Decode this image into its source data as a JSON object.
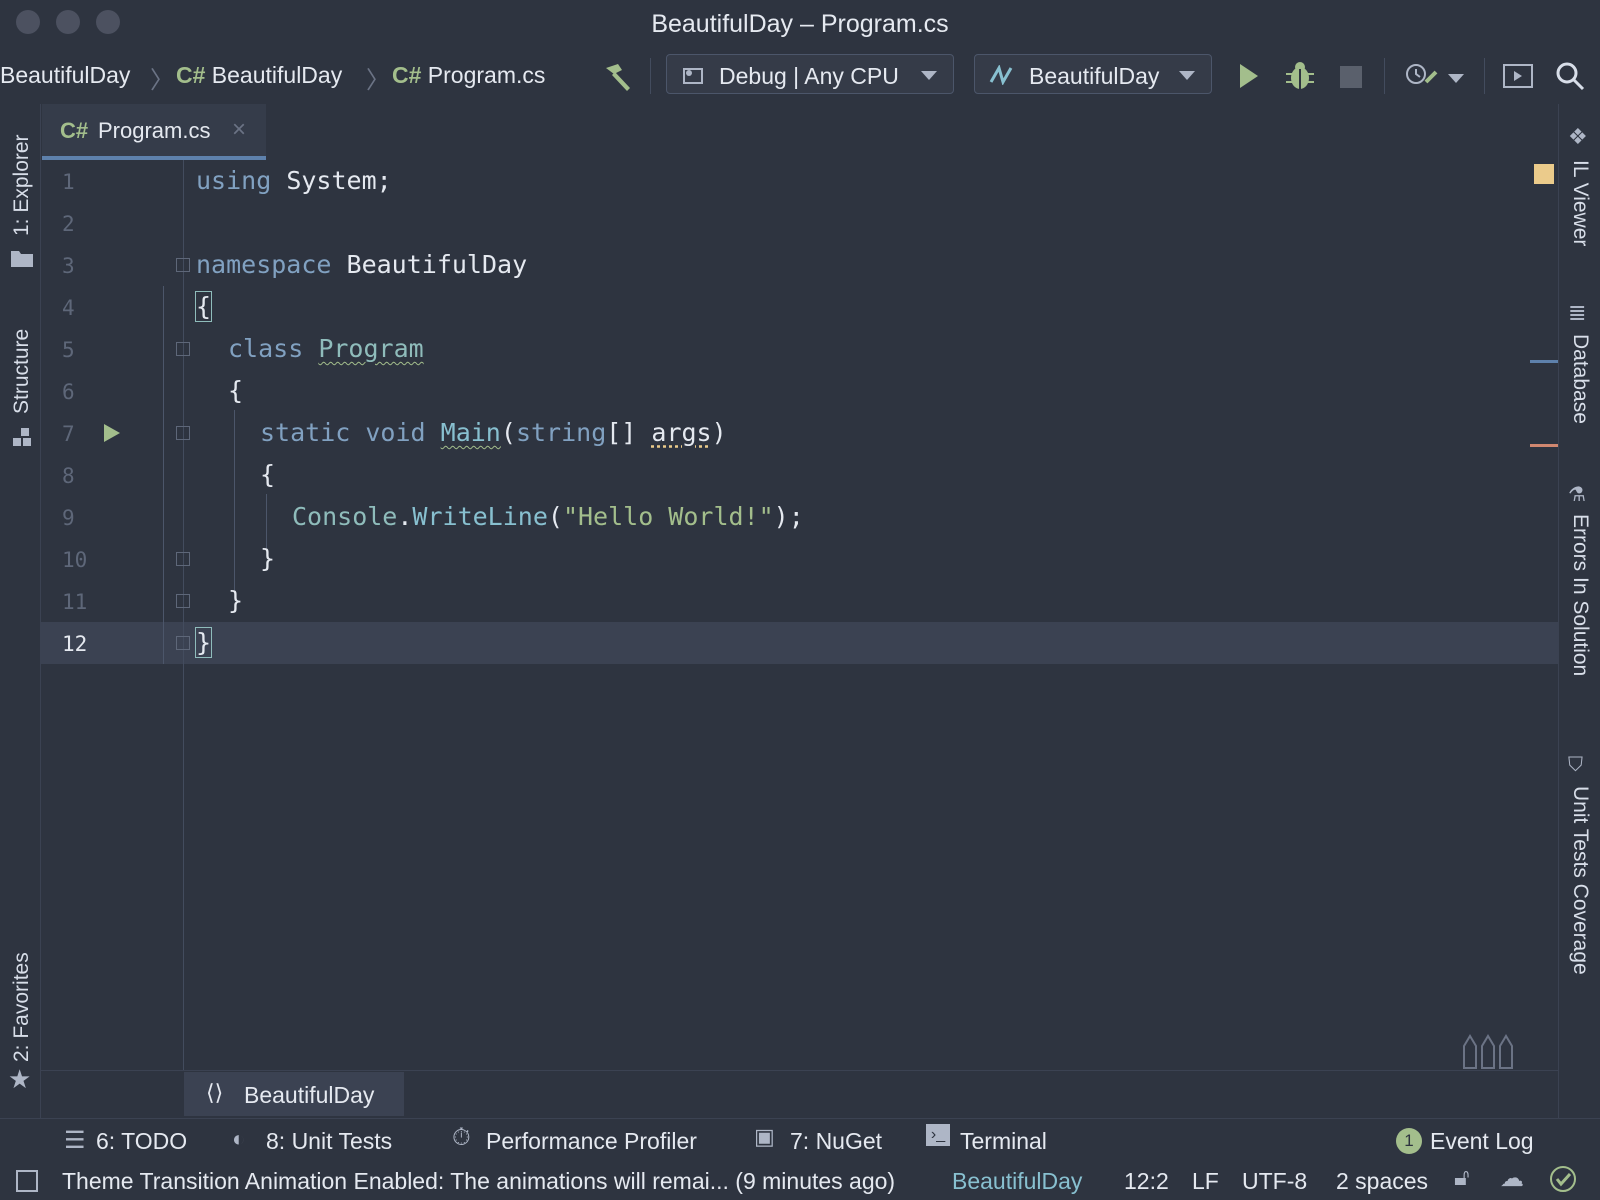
{
  "window": {
    "title": "BeautifulDay – Program.cs"
  },
  "breadcrumbs": [
    "BeautifulDay",
    "BeautifulDay",
    "Program.cs"
  ],
  "file_icon_label": "C#",
  "toolbar": {
    "config_label": "Debug | Any CPU",
    "run_target_label": "BeautifulDay"
  },
  "left_tabs": {
    "explorer": "1: Explorer",
    "structure": "Structure",
    "favorites": "2: Favorites"
  },
  "right_tabs": {
    "il_viewer": "IL Viewer",
    "database": "Database",
    "errors": "Errors In Solution",
    "coverage": "Unit Tests Coverage"
  },
  "editor_tab": {
    "label": "Program.cs"
  },
  "code": {
    "line_numbers": [
      "1",
      "2",
      "3",
      "4",
      "5",
      "6",
      "7",
      "8",
      "9",
      "10",
      "11",
      "12"
    ],
    "kw_using": "using",
    "system": " System;",
    "kw_namespace": "namespace",
    "ns_name": " BeautifulDay",
    "brace_open": "{",
    "brace_close": "}",
    "kw_class": "class",
    "class_name": "Program",
    "kw_static": "static",
    "kw_void": "void",
    "main": "Main",
    "paren_open": "(",
    "kw_string": "string",
    "arr": "[] ",
    "args": "args",
    "paren_close": ")",
    "console": "Console",
    "dot": ".",
    "writeline": "WriteLine",
    "str": "\"Hello World!\"",
    "end": ");"
  },
  "nav_breadcrumb": "BeautifulDay",
  "tool_windows": {
    "todo": "6: TODO",
    "unit_tests": "8: Unit Tests",
    "profiler": "Performance Profiler",
    "nuget": "7: NuGet",
    "terminal": "Terminal",
    "event_log": "Event Log",
    "event_log_count": "1"
  },
  "status": {
    "message": "Theme Transition Animation Enabled: The animations will remai... (9 minutes ago)",
    "project": "BeautifulDay",
    "position": "12:2",
    "line_ending": "LF",
    "encoding": "UTF-8",
    "indent": "2 spaces"
  },
  "colors": {
    "background": "#2e3440",
    "keyword": "#81a1c1",
    "string": "#a3be8c",
    "accent": "#5e81ac"
  }
}
